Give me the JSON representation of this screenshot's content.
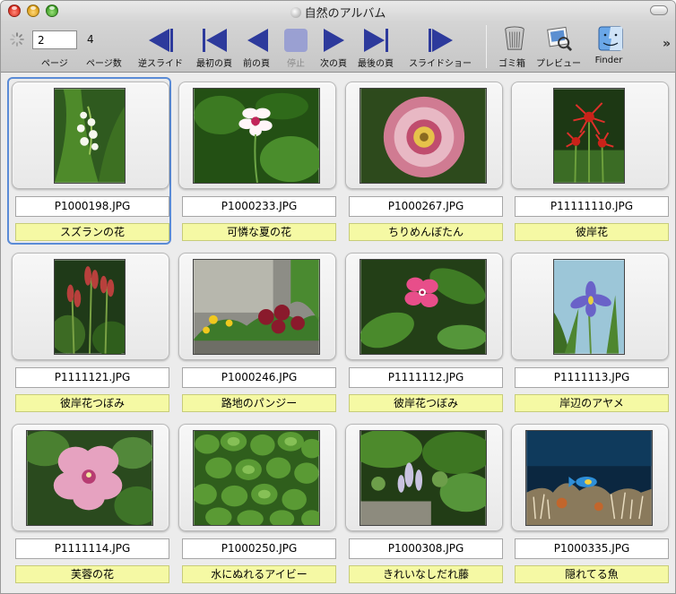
{
  "window": {
    "title": "自然のアルバム"
  },
  "toolbar": {
    "page_value": "2",
    "page_count": "4",
    "page_label": "ページ",
    "page_count_label": "ページ数",
    "reverse_slide": "逆スライド",
    "first_page": "最初の頁",
    "prev_page": "前の頁",
    "stop": "停止",
    "next_page": "次の頁",
    "last_page": "最後の頁",
    "slideshow": "スライドショー",
    "trash": "ゴミ箱",
    "preview": "プレビュー",
    "finder": "Finder"
  },
  "colors": {
    "nav_blue": "#2d3a9c",
    "caption_bg": "#f5f9a4",
    "selection": "#5a8bd6"
  },
  "photos": [
    {
      "file": "P1000198.JPG",
      "caption": "スズランの花",
      "subject": "lily-of-the-valley"
    },
    {
      "file": "P1000233.JPG",
      "caption": "可憐な夏の花",
      "subject": "pink-white-flower"
    },
    {
      "file": "P1000267.JPG",
      "caption": "ちりめんぼたん",
      "subject": "pink-poppy"
    },
    {
      "file": "P11111110.JPG",
      "caption": "彼岸花",
      "subject": "red-spider-lily"
    },
    {
      "file": "P1111121.JPG",
      "caption": "彼岸花つぼみ",
      "subject": "lily-buds"
    },
    {
      "file": "P1000246.JPG",
      "caption": "路地のパンジー",
      "subject": "pansies"
    },
    {
      "file": "P1111112.JPG",
      "caption": "彼岸花つぼみ",
      "subject": "pink-periwinkle"
    },
    {
      "file": "P1111113.JPG",
      "caption": "岸辺のアヤメ",
      "subject": "purple-iris"
    },
    {
      "file": "P1111114.JPG",
      "caption": "芙蓉の花",
      "subject": "pink-hibiscus"
    },
    {
      "file": "P1000250.JPG",
      "caption": "水にぬれるアイビー",
      "subject": "ivy"
    },
    {
      "file": "P1000308.JPG",
      "caption": "きれいなしだれ藤",
      "subject": "wisteria"
    },
    {
      "file": "P1000335.JPG",
      "caption": "隠れてる魚",
      "subject": "reef-fish"
    }
  ]
}
